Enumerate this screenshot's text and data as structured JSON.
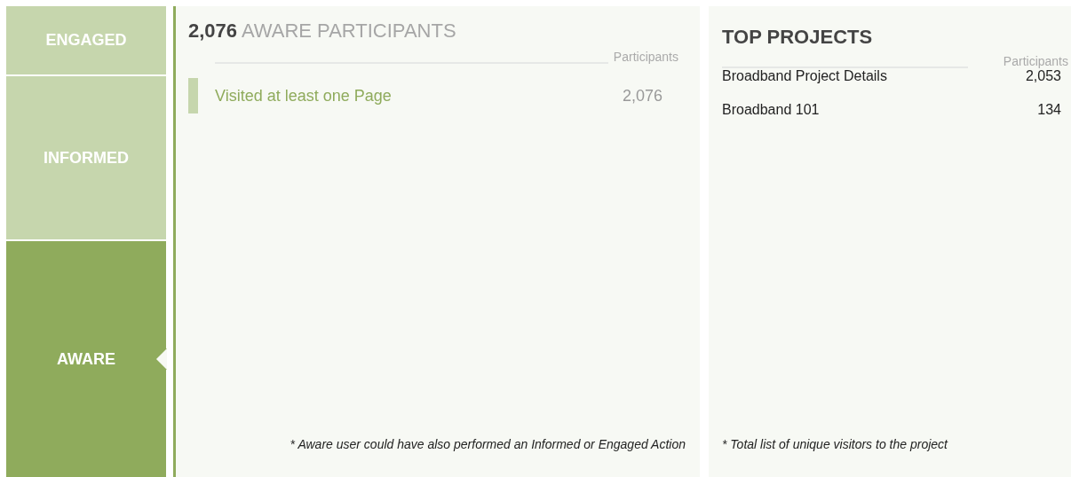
{
  "stages": [
    {
      "label": "ENGAGED",
      "selected": false
    },
    {
      "label": "INFORMED",
      "selected": false
    },
    {
      "label": "AWARE",
      "selected": true
    }
  ],
  "aware_panel": {
    "count": "2,076",
    "title": "AWARE PARTICIPANTS",
    "column_header": "Participants",
    "rows": [
      {
        "label": "Visited at least one Page",
        "value": "2,076"
      }
    ],
    "footnote": "* Aware user could have also performed an Informed or Engaged Action"
  },
  "top_projects": {
    "title": "TOP PROJECTS",
    "column_header": "Participants",
    "rows": [
      {
        "label": "Broadband Project Details",
        "value": "2,053"
      },
      {
        "label": "Broadband 101",
        "value": "134"
      }
    ],
    "footnote": "* Total list of unique visitors to the project"
  }
}
